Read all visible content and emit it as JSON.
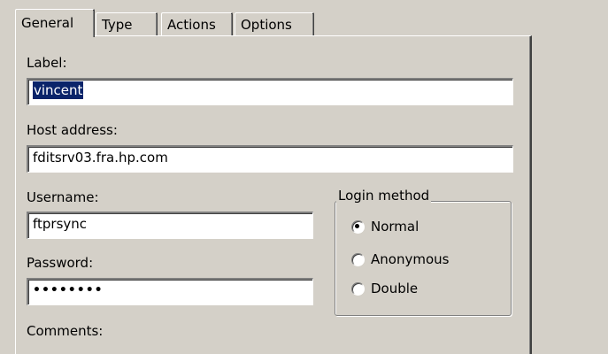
{
  "tabs": [
    {
      "label": "General",
      "active": true
    },
    {
      "label": "Type",
      "active": false
    },
    {
      "label": "Actions",
      "active": false
    },
    {
      "label": "Options",
      "active": false
    }
  ],
  "form": {
    "label_label": "Label:",
    "label_value": "vincent",
    "host_label": "Host address:",
    "host_value": "fditsrv03.fra.hp.com",
    "username_label": "Username:",
    "username_value": "ftprsync",
    "password_label": "Password:",
    "password_masked": "••••••••",
    "comments_label": "Comments:"
  },
  "login_method": {
    "legend": "Login method",
    "options": [
      {
        "label": "Normal",
        "checked": true
      },
      {
        "label": "Anonymous",
        "checked": false
      },
      {
        "label": "Double",
        "checked": false
      }
    ]
  },
  "colors": {
    "window_bg": "#d4d0c8",
    "selection_bg": "#0a246a",
    "selection_fg": "#ffffff"
  }
}
